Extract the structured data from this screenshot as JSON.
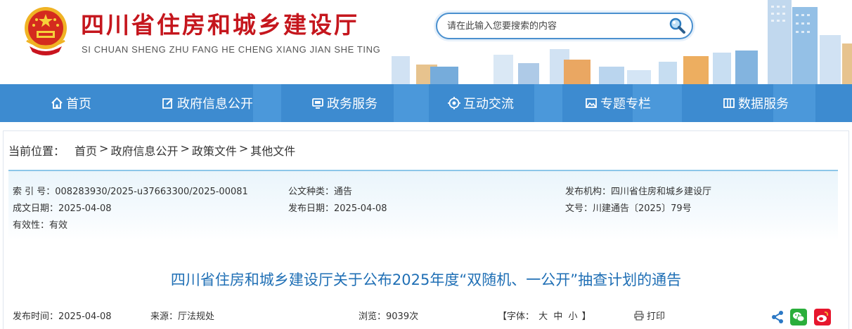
{
  "site": {
    "title": "四川省住房和城乡建设厅",
    "pinyin": "SI CHUAN SHENG ZHU FANG HE CHENG XIANG JIAN SHE TING"
  },
  "search": {
    "placeholder": "请在此输入您要搜索的内容",
    "icon": "magnifier-icon"
  },
  "nav": {
    "items": [
      {
        "label": "首页",
        "icon": "home-icon"
      },
      {
        "label": "政府信息公开",
        "icon": "edit-icon"
      },
      {
        "label": "政务服务",
        "icon": "monitor-icon"
      },
      {
        "label": "互动交流",
        "icon": "interaction-icon"
      },
      {
        "label": "专题专栏",
        "icon": "image-icon"
      },
      {
        "label": "数据服务",
        "icon": "columns-icon"
      }
    ]
  },
  "breadcrumb": {
    "label": "当前位置：",
    "items": [
      "首页",
      "政府信息公开",
      "政策文件",
      "其他文件"
    ],
    "separator": ">"
  },
  "meta": {
    "index_label": "索 引 号：",
    "index_value": "008283930/2025-u37663300/2025-00081",
    "type_label": "公文种类：",
    "type_value": "通告",
    "publisher_label": "发布机构：",
    "publisher_value": "四川省住房和城乡建设厅",
    "date_label": "成文日期：",
    "date_value": "2025-04-08",
    "pubdate_label": "发布日期：",
    "pubdate_value": "2025-04-08",
    "docno_label": "文号：",
    "docno_value": "川建通告〔2025〕79号",
    "validity_label": "有效性：",
    "validity_value": "有效"
  },
  "article": {
    "title": "四川省住房和城乡建设厅关于公布2025年度“双随机、一公开”抽查计划的通告",
    "time_label": "发布时间：",
    "time_value": "2025-04-08",
    "source_label": "来源：",
    "source_value": "厅法规处",
    "views_label": "浏览：",
    "views_value": "9039次",
    "font_label": "【字体：",
    "font_large": "大",
    "font_medium": "中",
    "font_small": "小",
    "font_end": "】",
    "print_label": "打印"
  },
  "share": {
    "icons": [
      "share-icon",
      "wechat-icon",
      "weibo-icon"
    ]
  },
  "colors": {
    "title_red": "#c5161d",
    "nav_blue": "#3d8bd0",
    "article_title_blue": "#1f6fb5",
    "wechat_green": "#2aae3b",
    "weibo_red": "#e6162d"
  }
}
